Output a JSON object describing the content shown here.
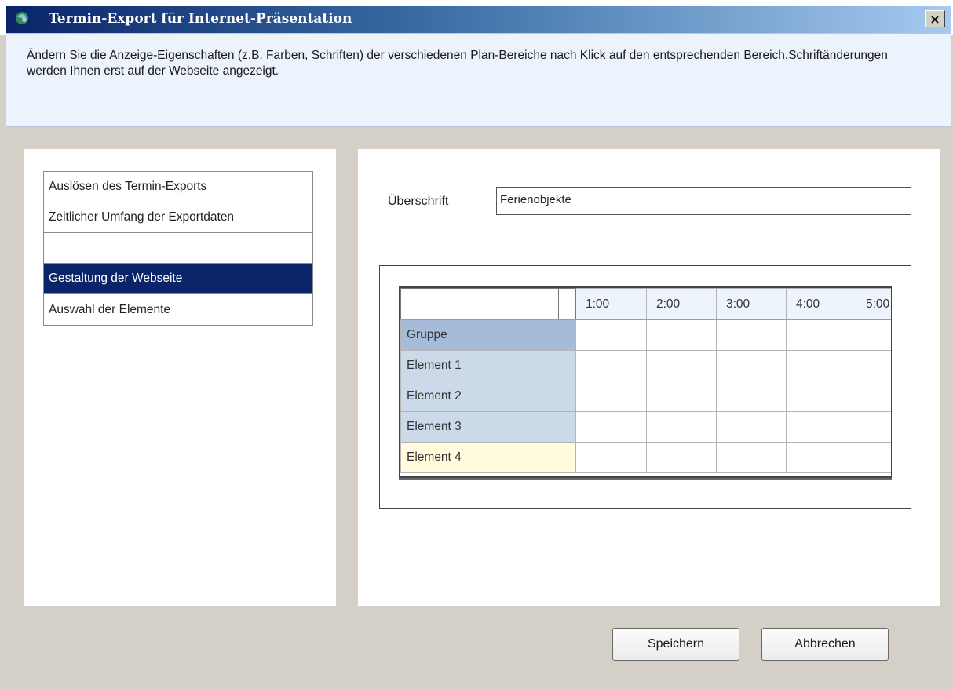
{
  "window": {
    "title": "Termin-Export für Internet-Präsentation",
    "close_label": "×"
  },
  "info": {
    "text": "Ändern Sie die Anzeige-Eigenschaften (z.B. Farben, Schriften) der verschiedenen Plan-Bereiche nach Klick auf den entsprechenden Bereich.Schriftänderungen werden Ihnen erst auf der Webseite angezeigt."
  },
  "nav": {
    "items": [
      {
        "label": "Auslösen des Termin-Exports"
      },
      {
        "label": "Zeitlicher Umfang der Exportdaten"
      },
      {
        "label": ""
      },
      {
        "label": "Gestaltung der Webseite"
      },
      {
        "label": "Auswahl der Elemente"
      }
    ],
    "selected_index": 3
  },
  "heading": {
    "label": "Überschrift",
    "value": "Ferienobjekte"
  },
  "plan": {
    "hours": [
      "1:00",
      "2:00",
      "3:00",
      "4:00",
      "5:00"
    ],
    "rows": [
      {
        "label": "Gruppe"
      },
      {
        "label": "Element 1"
      },
      {
        "label": "Element 2"
      },
      {
        "label": "Element 3"
      },
      {
        "label": "Element 4"
      }
    ]
  },
  "buttons": {
    "save": "Speichern",
    "cancel": "Abbrechen"
  },
  "colors": {
    "titlebar_start": "#0a246a",
    "titlebar_end": "#a6caf0",
    "selection": "#0a246a",
    "group_row": "#a6bbd7",
    "element_row": "#ccd9e8",
    "highlight_row": "#fffbdc",
    "hour_header": "#edf4fb"
  }
}
